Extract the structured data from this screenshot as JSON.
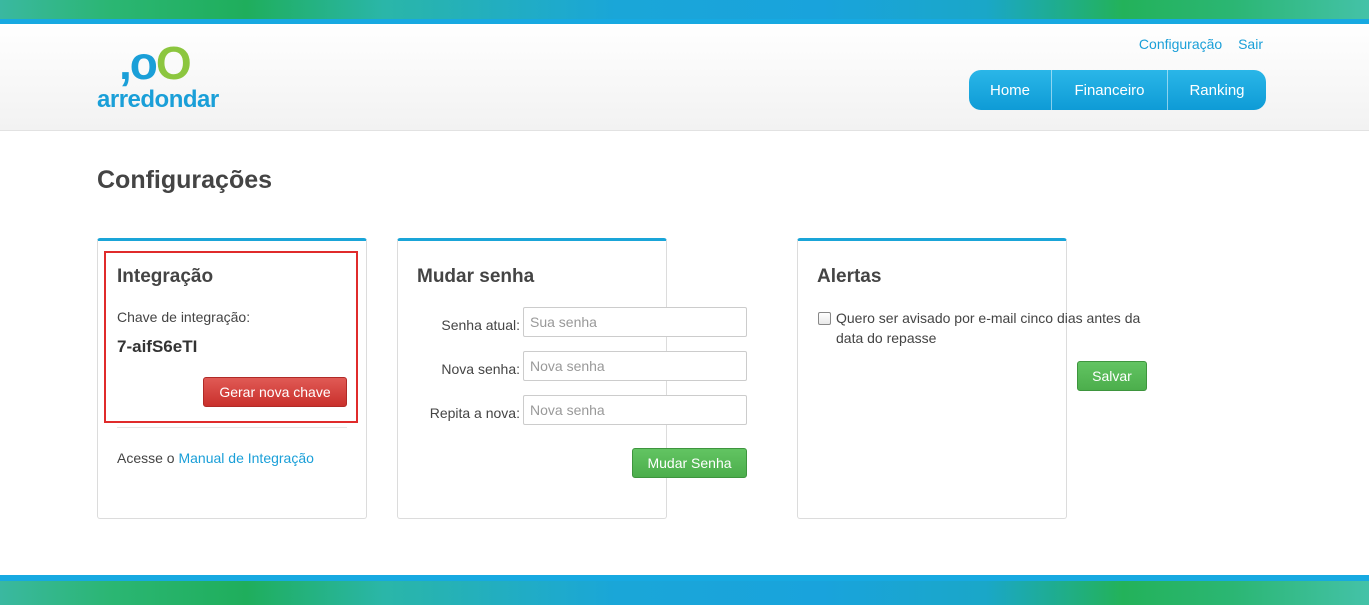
{
  "brand": {
    "logo_mark": {
      "comma": ",",
      "o1": "o",
      "o2": "O"
    },
    "logo_text": "arredondar",
    "colors": {
      "blue": "#1a9fd8",
      "green": "#8cc63f",
      "danger": "#c9302c",
      "success": "#4cae4c",
      "highlight": "#e02b2b"
    }
  },
  "top_links": {
    "config": "Configuração",
    "logout": "Sair"
  },
  "nav": {
    "items": [
      "Home",
      "Financeiro",
      "Ranking"
    ]
  },
  "page": {
    "title": "Configurações"
  },
  "integracao": {
    "title": "Integração",
    "key_label": "Chave de integração:",
    "key_value": "7-aifS6eTI",
    "generate_button": "Gerar nova chave",
    "footer_prefix": "Acesse o",
    "footer_link": "Manual de Integração"
  },
  "senha": {
    "title": "Mudar senha",
    "current_label": "Senha atual:",
    "current_placeholder": "Sua senha",
    "new_label": "Nova senha:",
    "new_placeholder": "Nova senha",
    "repeat_label": "Repita a nova:",
    "repeat_placeholder": "Nova senha",
    "submit_button": "Mudar Senha"
  },
  "alertas": {
    "title": "Alertas",
    "checkbox_label": "Quero ser avisado por e-mail cinco dias antes da data do repasse",
    "checked": false,
    "save_button": "Salvar"
  }
}
